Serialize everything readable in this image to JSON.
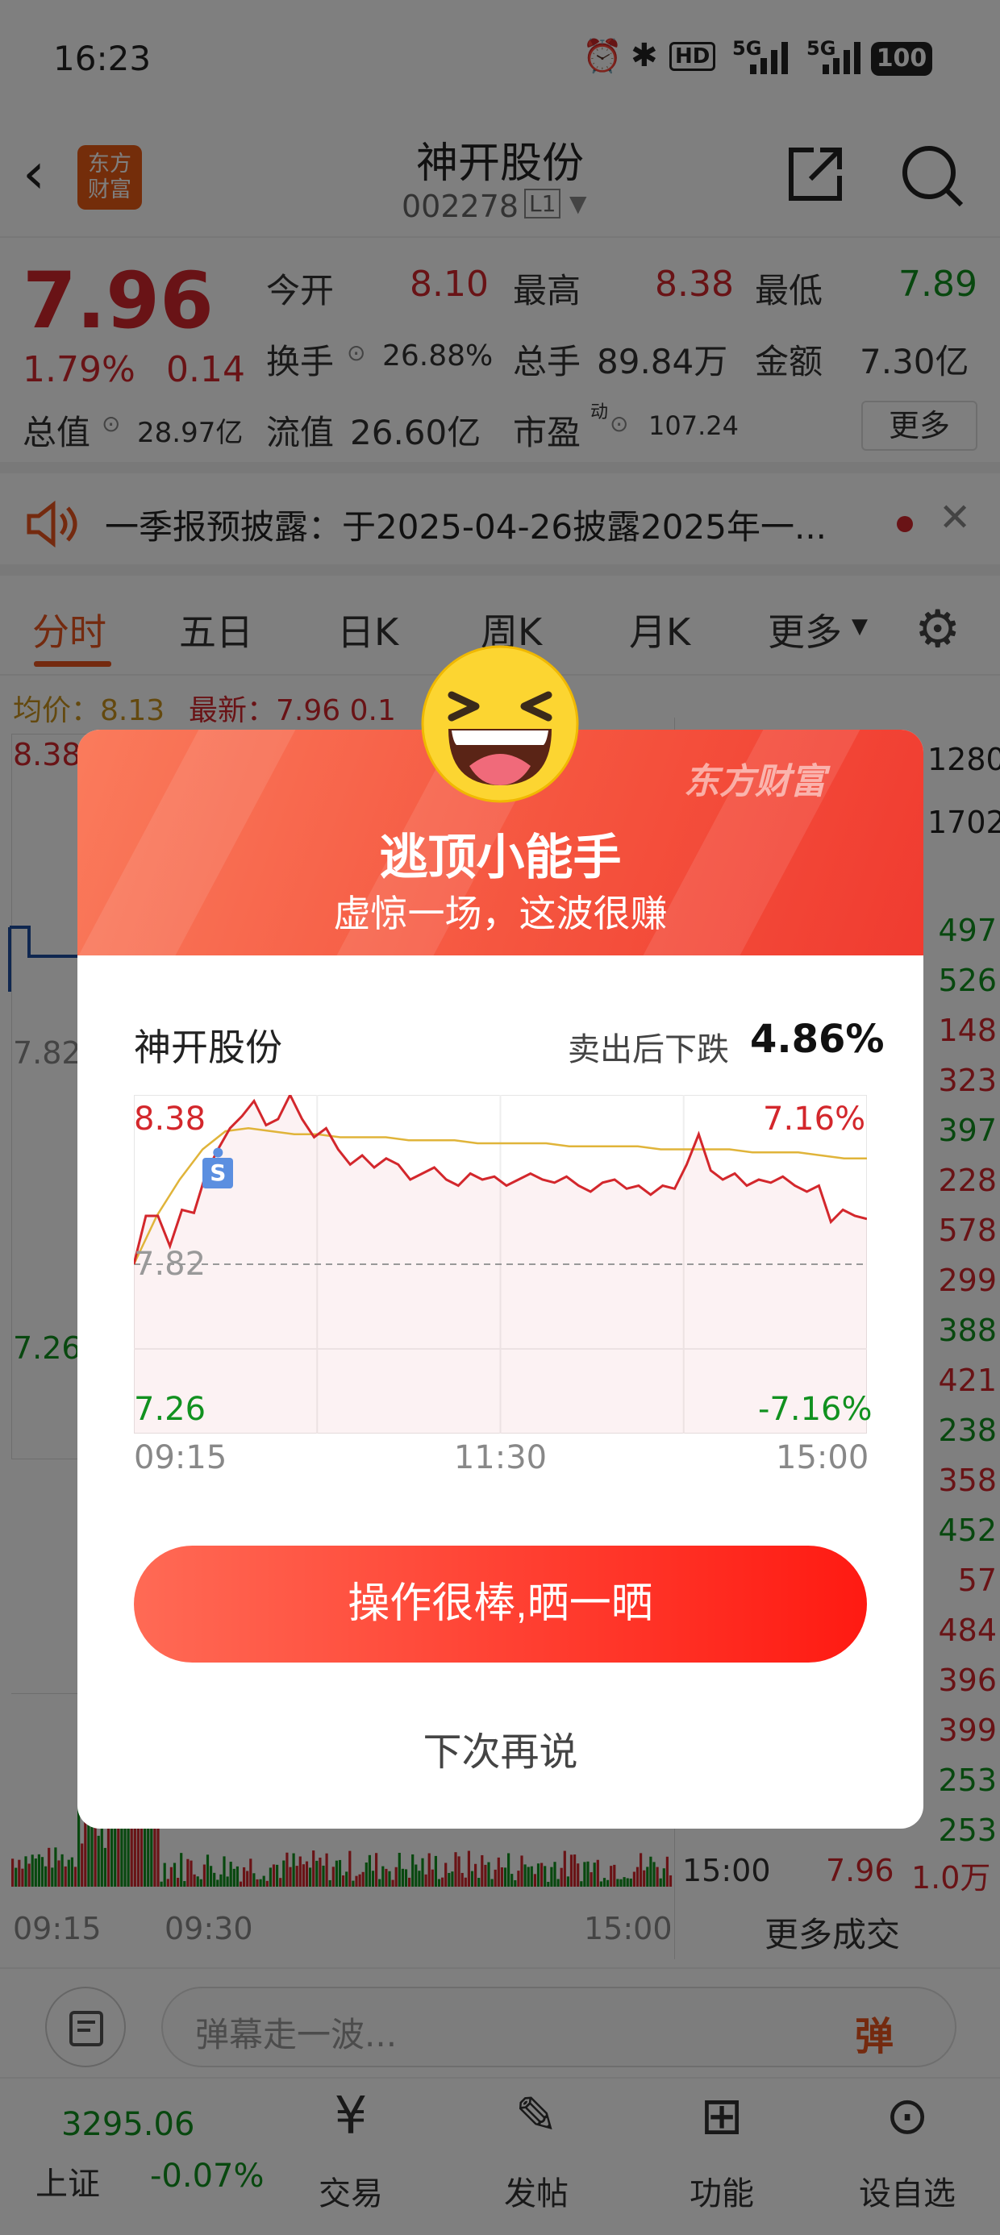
{
  "status_bar": {
    "time": "16:23",
    "battery": "100",
    "network": "5G"
  },
  "header": {
    "title": "神开股份",
    "code": "002278",
    "level": "L1",
    "logo_text_1": "东方",
    "logo_text_2": "财富"
  },
  "quote": {
    "price": "7.96",
    "change_pct": "1.79%",
    "change": "0.14",
    "fields": [
      {
        "label": "今开",
        "value": "8.10"
      },
      {
        "label": "最高",
        "value": "8.38"
      },
      {
        "label": "最低",
        "value": "7.89"
      },
      {
        "label": "换手",
        "value": "26.88%"
      },
      {
        "label": "总手",
        "value": "89.84万"
      },
      {
        "label": "金额",
        "value": "7.30亿"
      },
      {
        "label": "总值",
        "value": "28.97亿"
      },
      {
        "label": "流值",
        "value": "26.60亿"
      },
      {
        "label": "市盈",
        "value": "107.24",
        "sup": "动"
      }
    ],
    "more": "更多"
  },
  "notice": {
    "text": "一季报预披露：于2025-04-26披露2025年一..."
  },
  "tabs": [
    "分时",
    "五日",
    "日K",
    "周K",
    "月K",
    "更多"
  ],
  "chart_header": {
    "avg_label": "均价：",
    "avg_value": "8.13",
    "latest_label": "最新：",
    "latest_value": "7.96",
    "extra": "0.1"
  },
  "bg_chart": {
    "y_high": "8.38",
    "y_mid": "7.82",
    "y_low": "7.26",
    "x_start": "09:15",
    "x_mid": "09:30",
    "x_end": "15:00"
  },
  "right_column": [
    "1280",
    "1702",
    "497",
    "526",
    "148",
    "323",
    "397",
    "228",
    "578",
    "299",
    "388",
    "421",
    "238",
    "358",
    "452",
    "57",
    "484",
    "396",
    "399",
    "253",
    "253"
  ],
  "trade_row": {
    "time": "15:00",
    "price": "7.96",
    "vol": "1.0万",
    "more": "更多成交"
  },
  "comment": {
    "placeholder": "弹幕走一波...",
    "danmu": "弹"
  },
  "bottom_nav": {
    "index_value": "3295.06",
    "index_name": "上证",
    "index_change": "-0.07%",
    "items": [
      "交易",
      "发帖",
      "功能",
      "设自选"
    ]
  },
  "modal": {
    "brand": "东方财富",
    "title": "逃顶小能手",
    "subtitle": "虚惊一场，这波很赚",
    "stock_name": "神开股份",
    "drop_label": "卖出后下跌",
    "drop_value": "4.86%",
    "share_button": "操作很棒,晒一晒",
    "later": "下次再说",
    "sell_marker": "S"
  },
  "chart_data": {
    "type": "line",
    "title": "",
    "x_ticks": [
      "09:15",
      "11:30",
      "15:00"
    ],
    "ylim": [
      7.26,
      8.38
    ],
    "y_ticks_left": [
      "8.38",
      "7.82",
      "7.26"
    ],
    "y_ticks_right": [
      "7.16%",
      "-7.16%"
    ],
    "baseline": 7.82,
    "series": [
      {
        "values": [
          7.82,
          7.98,
          7.98,
          7.88,
          8.0,
          7.99,
          8.12,
          8.2,
          8.27,
          8.31,
          8.36,
          8.28,
          8.3,
          8.38,
          8.3,
          8.24,
          8.27,
          8.2,
          8.15,
          8.18,
          8.14,
          8.17,
          8.15,
          8.1,
          8.12,
          8.14,
          8.1,
          8.08,
          8.12,
          8.1,
          8.11,
          8.08,
          8.1,
          8.12,
          8.1,
          8.09,
          8.11,
          8.08,
          8.06,
          8.09,
          8.1,
          8.07,
          8.08,
          8.05,
          8.08,
          8.07,
          8.15,
          8.25,
          8.13,
          8.1,
          8.12,
          8.08,
          8.1,
          8.09,
          8.11,
          8.08,
          8.06,
          8.08,
          7.96,
          8.0,
          7.98,
          7.97
        ]
      },
      {
        "values": [
          7.82,
          7.98,
          8.1,
          8.2,
          8.26,
          8.27,
          8.26,
          8.25,
          8.25,
          8.24,
          8.24,
          8.24,
          8.23,
          8.23,
          8.23,
          8.22,
          8.22,
          8.22,
          8.22,
          8.21,
          8.21,
          8.21,
          8.21,
          8.2,
          8.2,
          8.2,
          8.2,
          8.19,
          8.19,
          8.19,
          8.18,
          8.17,
          8.17
        ]
      }
    ]
  },
  "colors": {
    "up": "#d3272c",
    "down": "#11911f",
    "accent": "#e8541e",
    "avg_line": "#e0b43a"
  }
}
